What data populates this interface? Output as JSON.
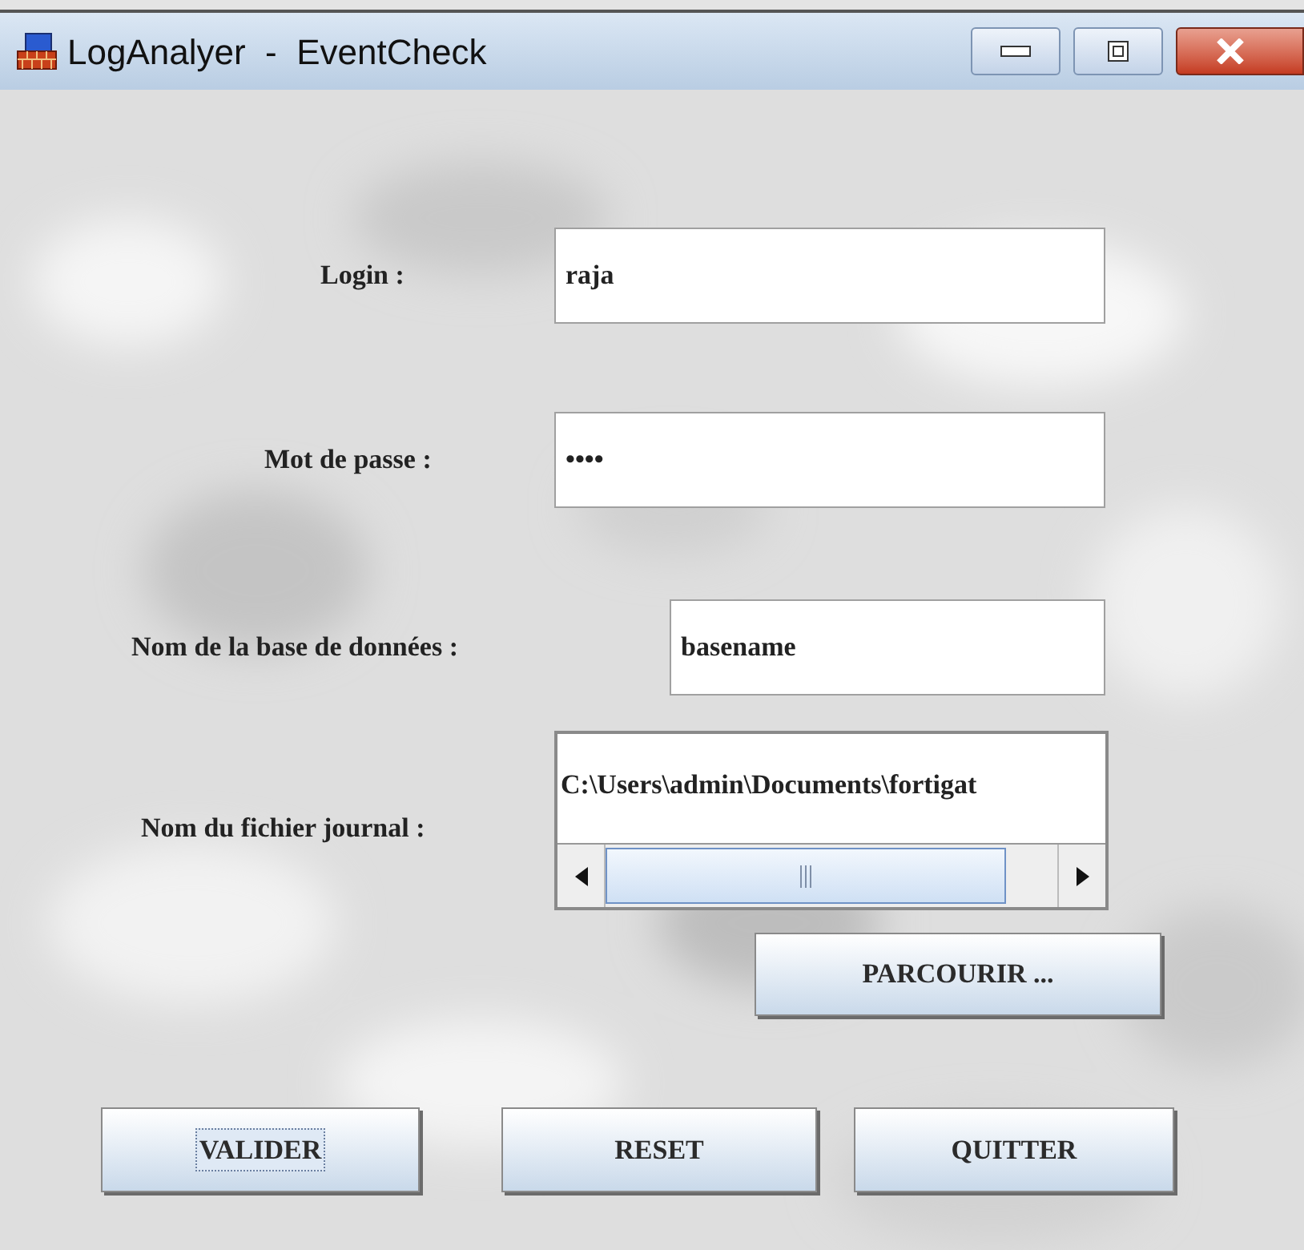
{
  "window": {
    "title": "LogAnalyer  -  EventCheck"
  },
  "fields": [
    {
      "label": "Login :",
      "value": "raja"
    },
    {
      "label": "Mot de passe :",
      "value": "••••"
    },
    {
      "label": "Nom de la base de données :",
      "value": "basename"
    },
    {
      "label": "Nom du fichier journal :",
      "value": "C:\\Users\\admin\\Documents\\fortigat"
    }
  ],
  "browse_button": {
    "label": "PARCOURIR ..."
  },
  "buttons": [
    {
      "label": "VALIDER",
      "focused": true
    },
    {
      "label": "RESET",
      "focused": false
    },
    {
      "label": "QUITTER",
      "focused": false
    }
  ]
}
